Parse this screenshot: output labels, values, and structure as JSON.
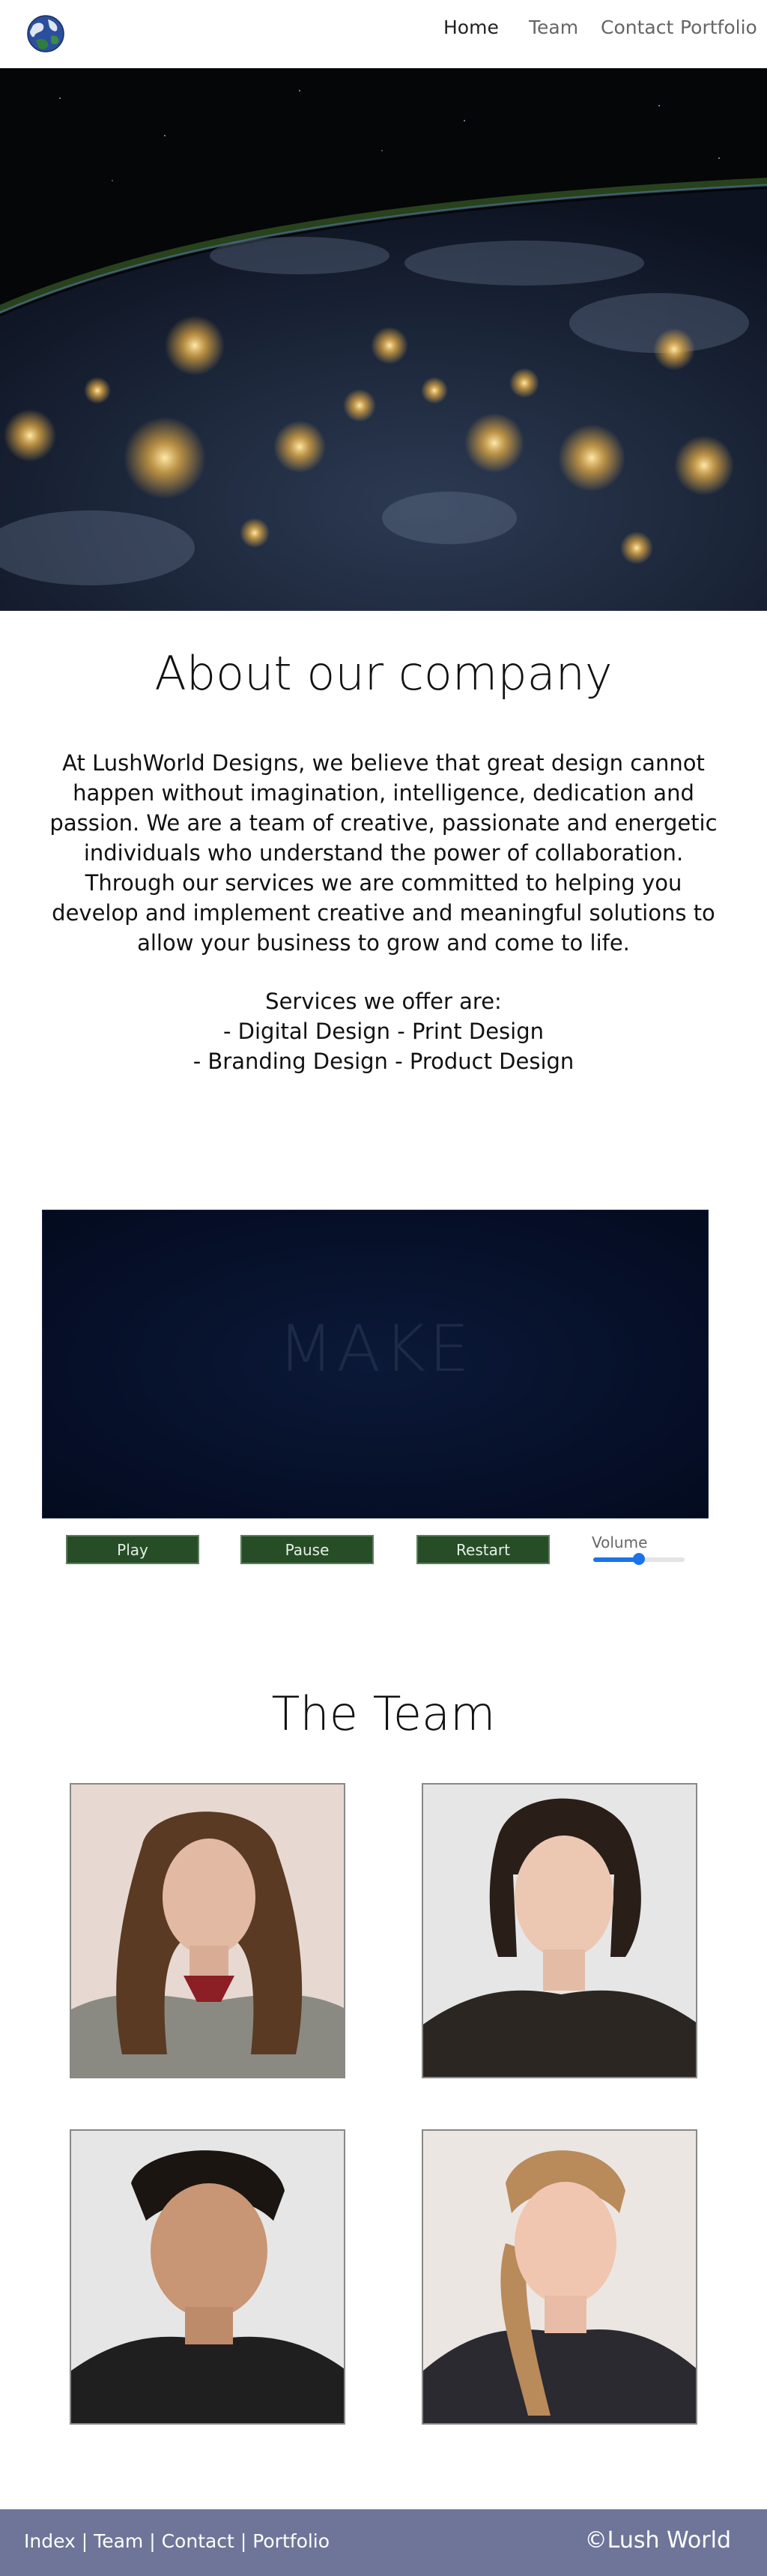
{
  "nav": {
    "logo_alt": "globe logo",
    "links": [
      {
        "label": "Home",
        "active": true
      },
      {
        "label": "Team",
        "active": false
      },
      {
        "label": "Contact",
        "active": false
      },
      {
        "label": "Portfolio",
        "active": false
      }
    ]
  },
  "hero": {
    "image_subject": "earth at night from space"
  },
  "about": {
    "title": "About our company",
    "paragraph": "At LushWorld Designs, we believe that great design cannot happen without imagination, intelligence, dedication and passion. We are a team of creative, passionate and energetic individuals who understand the power of collaboration. Through our services we are committed to helping you develop and implement creative and meaningful solutions to allow your business to grow and come to life.",
    "services_title": "Services we offer are:",
    "services_line1": "- Digital Design  - Print Design",
    "services_line2": "- Branding Design  - Product Design"
  },
  "video": {
    "overlay_text": "MAKE",
    "buttons": {
      "play": "Play",
      "pause": "Pause",
      "restart": "Restart"
    },
    "volume_label": "Volume",
    "volume_level": 0.5
  },
  "team": {
    "title": "The Team"
  },
  "footer": {
    "links": [
      "Index",
      "Team",
      "Contact",
      "Portfolio"
    ],
    "separator": "|",
    "copyright": "©Lush World"
  },
  "colors": {
    "button_bg": "#264d26",
    "footer_bg": "#6e7599",
    "slider_accent": "#1a73e8"
  }
}
